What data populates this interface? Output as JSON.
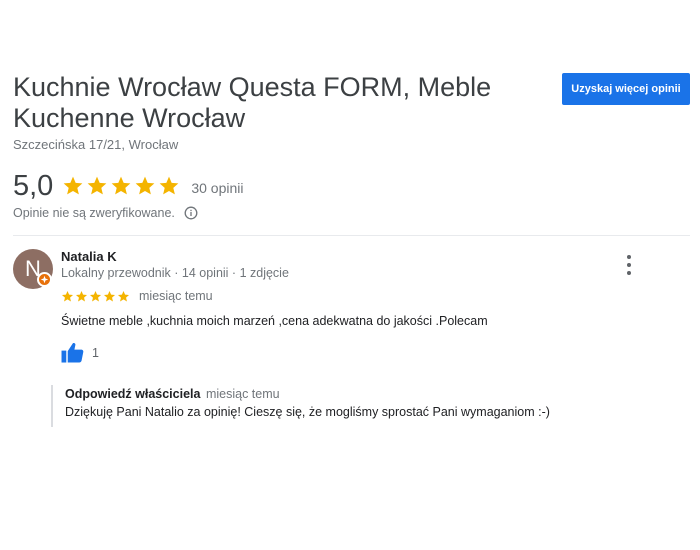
{
  "business": {
    "name": "Kuchnie Wrocław Questa FORM, Meble Kuchenne Wrocław",
    "address": "Szczecińska 17/21, Wrocław",
    "rating": "5,0",
    "rating_stars": 5,
    "review_count": "30 opinii",
    "unverified_note": "Opinie nie są zweryfikowane."
  },
  "actions": {
    "get_more_reviews_label": "Uzyskaj więcej opinii"
  },
  "colors": {
    "star": "#f4b400",
    "button": "#1a73e8",
    "avatar_bg": "#8d6e63",
    "badge": "#e8710a",
    "like": "#1a73e8"
  },
  "review": {
    "author": "Natalia K",
    "avatar_initial": "N",
    "author_meta": "Lokalny przewodnik · 14 opinii · 1 zdjęcie",
    "stars": 5,
    "date": "miesiąc temu",
    "text": "Świetne meble ,kuchnia moich marzeń ,cena adekwatna do jakości .Polecam",
    "likes": "1",
    "owner_reply": {
      "label": "Odpowiedź właściciela",
      "date": "miesiąc temu",
      "text": "Dziękuję Pani Natalio za opinię! Cieszę się, że mogliśmy sprostać Pani wymaganiom :-)"
    }
  },
  "icons": {
    "star": "star-icon",
    "info": "info-icon",
    "more": "more-vert-icon",
    "like": "thumb-up-icon",
    "badge": "local-guide-badge-icon"
  }
}
